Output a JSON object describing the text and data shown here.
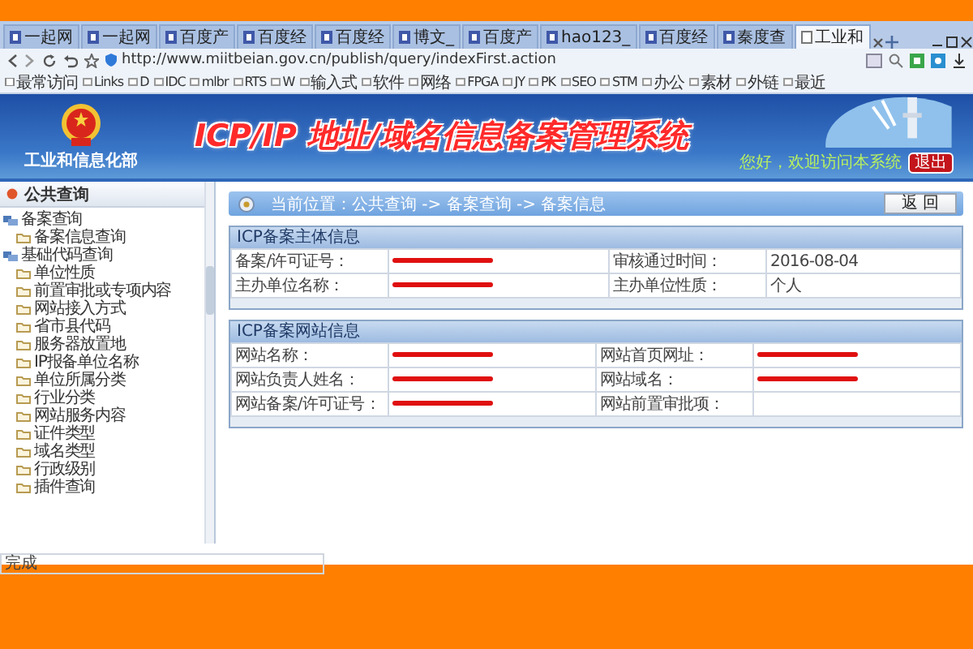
{
  "browser": {
    "tabs": [
      {
        "label": "一起网",
        "selected": false
      },
      {
        "label": "一起网",
        "selected": false
      },
      {
        "label": "百度产",
        "selected": false
      },
      {
        "label": "百度经",
        "selected": false
      },
      {
        "label": "百度经",
        "selected": false
      },
      {
        "label": "博文_",
        "selected": false
      },
      {
        "label": "百度产",
        "selected": false
      },
      {
        "label": "hao123_",
        "selected": false
      },
      {
        "label": "百度经",
        "selected": false
      },
      {
        "label": "秦度查",
        "selected": false
      },
      {
        "label": "工业和",
        "selected": true
      }
    ],
    "address": "http://www.miitbeian.gov.cn/publish/query/indexFirst.action",
    "bookmarks": [
      "最常访问",
      "Links",
      "D",
      "IDC",
      "mlbr",
      "RTS",
      "W",
      "输入式",
      "软件",
      "网络",
      "FPGA",
      "JY",
      "PK",
      "SEO",
      "STM",
      "办公",
      "素材",
      "外链",
      "最近"
    ]
  },
  "header": {
    "ministry": "工业和信息化部",
    "title": "ICP/IP 地址/域名信息备案管理系统",
    "greeting": "您好，欢迎访问本系统",
    "logout": "退出"
  },
  "sidebar": {
    "title": "公共查询",
    "items": [
      {
        "label": "备案查询",
        "children": [
          {
            "label": "备案信息查询"
          }
        ]
      },
      {
        "label": "基础代码查询",
        "children": [
          {
            "label": "单位性质"
          },
          {
            "label": "前置审批或专项内容"
          },
          {
            "label": "网站接入方式"
          },
          {
            "label": "省市县代码"
          },
          {
            "label": "服务器放置地"
          },
          {
            "label": "IP报备单位名称"
          },
          {
            "label": "单位所属分类"
          },
          {
            "label": "行业分类"
          },
          {
            "label": "网站服务内容"
          },
          {
            "label": "证件类型"
          },
          {
            "label": "域名类型"
          },
          {
            "label": "行政级别"
          },
          {
            "label": "插件查询"
          }
        ]
      }
    ]
  },
  "breadcrumb": "当前位置：公共查询 -> 备案查询 -> 备案信息",
  "back_button": "返 回",
  "sections": [
    {
      "title": "ICP备案主体信息",
      "rows": [
        [
          {
            "label": "备案/许可证号：",
            "redacted": true
          },
          {
            "label": "审核通过时间：",
            "value": "2016-08-04",
            "redacted": false
          }
        ],
        [
          {
            "label": "主办单位名称：",
            "redacted": true
          },
          {
            "label": "主办单位性质：",
            "value": "个人",
            "redacted": false
          }
        ]
      ]
    },
    {
      "title": "ICP备案网站信息",
      "rows": [
        [
          {
            "label": "网站名称：",
            "redacted": true
          },
          {
            "label": "网站首页网址：",
            "redacted": true
          }
        ],
        [
          {
            "label": "网站负责人姓名：",
            "redacted": true
          },
          {
            "label": "网站域名：",
            "redacted": true
          }
        ],
        [
          {
            "label": "网站备案/许可证号：",
            "redacted": true
          },
          {
            "label": "网站前置审批项：",
            "redacted": false
          }
        ]
      ]
    }
  ],
  "status_bar": "完成"
}
